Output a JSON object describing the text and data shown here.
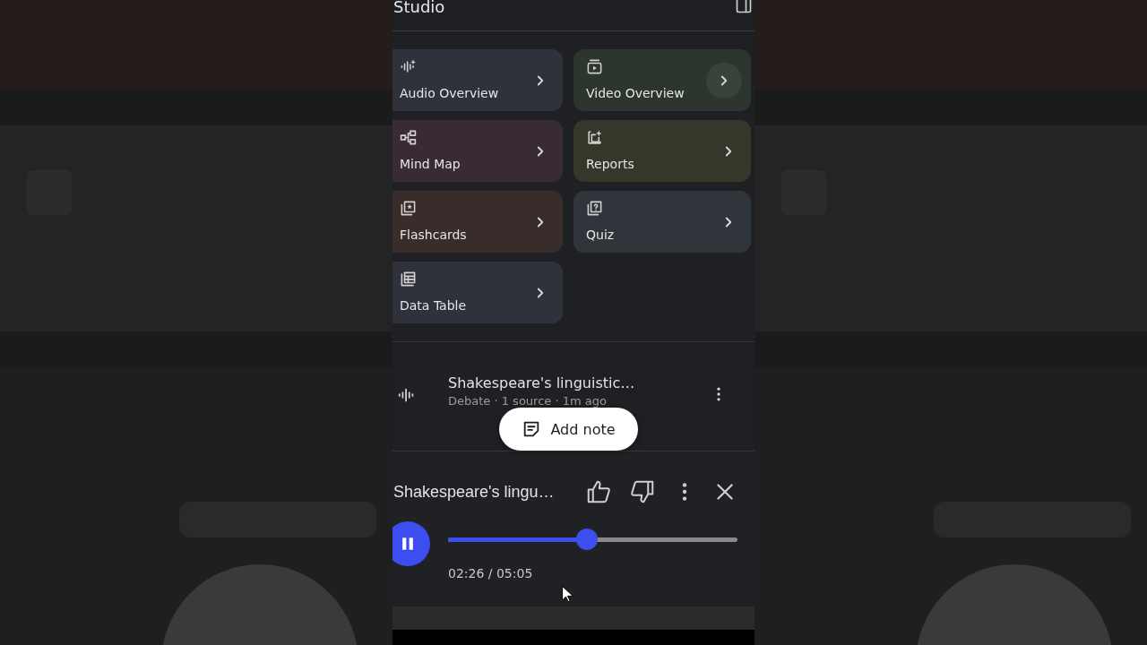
{
  "header": {
    "title": "Studio"
  },
  "tiles": [
    {
      "label": "Audio Overview",
      "kind": "audio",
      "color": "#2f323b",
      "hovered": false
    },
    {
      "label": "Video Overview",
      "kind": "video",
      "color": "#2d352f",
      "hovered": true
    },
    {
      "label": "Mind Map",
      "kind": "mindmap",
      "color": "#392b34",
      "hovered": false
    },
    {
      "label": "Reports",
      "kind": "reports",
      "color": "#36372a",
      "hovered": false
    },
    {
      "label": "Flashcards",
      "kind": "flashcards",
      "color": "#392d2b",
      "hovered": false
    },
    {
      "label": "Quiz",
      "kind": "quiz",
      "color": "#30353b",
      "hovered": false
    },
    {
      "label": "Data Table",
      "kind": "table",
      "color": "#30323b",
      "hovered": false
    }
  ],
  "note_item": {
    "title": "Shakespeare's linguistic…",
    "subtitle": "Debate · 1 source · 1m ago"
  },
  "toast": {
    "label": "Add note"
  },
  "player": {
    "title": "Shakespeare's lingu…",
    "playing": true,
    "level": 0.48,
    "time": "02:26 / 05:05"
  }
}
